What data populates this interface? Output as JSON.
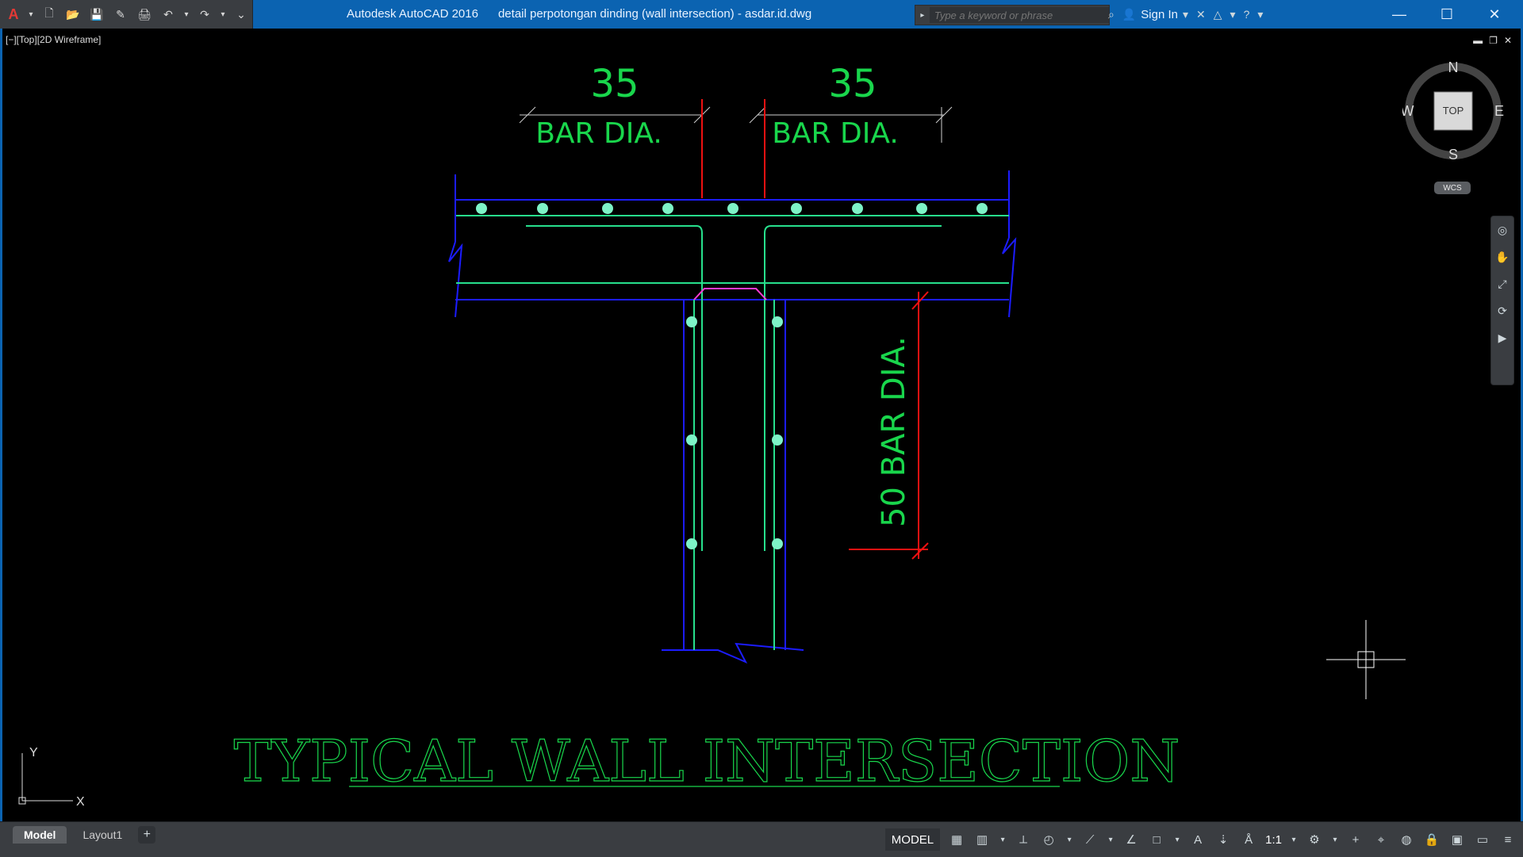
{
  "app": {
    "title_product": "Autodesk AutoCAD 2016",
    "title_file": "detail perpotongan dinding (wall intersection) - asdar.id.dwg",
    "colors": {
      "titlebar": "#0b63b1",
      "dark": "#3a3d41",
      "canvas": "#000000"
    }
  },
  "search": {
    "placeholder": "Type a keyword or phrase"
  },
  "user": {
    "signin_label": "Sign In"
  },
  "viewport": {
    "label": "[−][Top][2D Wireframe]",
    "wcs": "WCS",
    "viewcube": {
      "face": "TOP",
      "N": "N",
      "S": "S",
      "E": "E",
      "W": "W"
    }
  },
  "drawing": {
    "title": "TYPICAL WALL INTERSECTION",
    "dims": {
      "left_num": "35",
      "left_text": "BAR DIA.",
      "right_num": "35",
      "right_text": "BAR DIA.",
      "vertical_text": "50 BAR DIA."
    }
  },
  "tabs": {
    "model": "Model",
    "layout1": "Layout1",
    "add": "+"
  },
  "status": {
    "model": "MODEL",
    "scale": "1:1"
  },
  "icons": {
    "qat": [
      "app-logo",
      "new-icon",
      "open-icon",
      "save-icon",
      "saveas-icon",
      "print-icon",
      "undo-icon",
      "redo-icon",
      "customize-icon"
    ],
    "search_tools": [
      "binoculars-icon",
      "user-icon",
      "exchange-icon",
      "a360-icon",
      "help-icon"
    ],
    "nav_bar": [
      "steeringwheel-icon",
      "pan-icon",
      "zoom-icon",
      "orbit-icon",
      "showmotion-icon"
    ]
  }
}
